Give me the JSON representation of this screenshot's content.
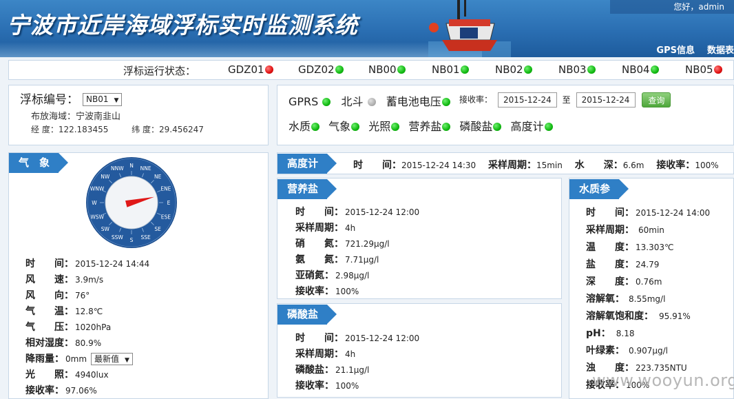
{
  "header": {
    "title": "宁波市近岸海域浮标实时监测系统",
    "user": "您好，admin",
    "nav": [
      "GPS信息",
      "数据表"
    ]
  },
  "status": {
    "label": "浮标运行状态：",
    "items": [
      {
        "name": "GDZ01",
        "state": "red"
      },
      {
        "name": "GDZ02",
        "state": "green"
      },
      {
        "name": "NB00",
        "state": "green"
      },
      {
        "name": "NB01",
        "state": "green"
      },
      {
        "name": "NB02",
        "state": "green"
      },
      {
        "name": "NB03",
        "state": "green"
      },
      {
        "name": "NB04",
        "state": "green"
      },
      {
        "name": "NB05",
        "state": "red"
      }
    ]
  },
  "buoy": {
    "label": "浮标编号：",
    "selected": "NB01",
    "area": "布放海域：宁波南韭山",
    "lon": "经 度：122.183455",
    "lat": "纬 度：29.456247"
  },
  "sensors": {
    "gprs": "GPRS",
    "beidou": "北斗",
    "battery": "蓄电池电压",
    "rate_label": "接收率：",
    "date_from": "2015-12-24",
    "to": "至",
    "date_to": "2015-12-24",
    "query": "查询",
    "row2": [
      "水质",
      "气象",
      "光照",
      "营养盐",
      "磷酸盐",
      "高度计"
    ]
  },
  "weather": {
    "tab": "气　象",
    "compass": [
      "N",
      "NNE",
      "NE",
      "ENE",
      "E",
      "ESE",
      "SE",
      "SSE",
      "S",
      "SSW",
      "SW",
      "WSW",
      "W",
      "WNW",
      "NW",
      "NNW"
    ],
    "direction_deg": 76,
    "rows": [
      {
        "k": "时　　间：",
        "v": "2015-12-24 14:44"
      },
      {
        "k": "风　　速：",
        "v": "3.9m/s"
      },
      {
        "k": "风　　向：",
        "v": "76°"
      },
      {
        "k": "气　　温：",
        "v": "12.8℃"
      },
      {
        "k": "气　　压：",
        "v": "1020hPa"
      },
      {
        "k": "相对湿度：",
        "v": "80.9%"
      },
      {
        "k": "降雨量：",
        "v": "0mm"
      },
      {
        "k": "光　　照：",
        "v": "4940lux"
      },
      {
        "k": "接收率：",
        "v": "97.06%"
      }
    ],
    "rain_select": "最新值"
  },
  "height": {
    "tab": "高度计",
    "time_label": "时　　间：",
    "time": "2015-12-24 14:30",
    "period_label": "采样周期：",
    "period": "15min",
    "depth_label": "水　　深：",
    "depth": "6.6m",
    "rate_label": "接收率：",
    "rate": "100%"
  },
  "nutrient": {
    "tab": "营养盐",
    "rows": [
      {
        "k": "时　　间：",
        "v": "2015-12-24 12:00"
      },
      {
        "k": "采样周期：",
        "v": "4h"
      },
      {
        "k": "硝　　氮：",
        "v": "721.29μg/l"
      },
      {
        "k": "氨　　氮：",
        "v": "7.71μg/l"
      },
      {
        "k": "亚硝氮：",
        "v": "2.98μg/l"
      },
      {
        "k": "接收率：",
        "v": "100%"
      }
    ]
  },
  "phosphate": {
    "tab": "磷酸盐",
    "rows": [
      {
        "k": "时　　间：",
        "v": "2015-12-24 12:00"
      },
      {
        "k": "采样周期：",
        "v": "4h"
      },
      {
        "k": "磷酸盐：",
        "v": "21.1μg/l"
      },
      {
        "k": "接收率：",
        "v": "100%"
      }
    ]
  },
  "waterquality": {
    "tab": "水质参数",
    "rows": [
      {
        "k": "时　　间：",
        "v": "2015-12-24 14:00"
      },
      {
        "k": "采样周期：",
        "v": "60min"
      },
      {
        "k": "温　　度：",
        "v": "13.303℃"
      },
      {
        "k": "盐　　度：",
        "v": "24.79"
      },
      {
        "k": "深　　度：",
        "v": "0.76m"
      },
      {
        "k": "溶解氧：",
        "v": "8.55mg/l"
      },
      {
        "k": "溶解氧饱和度：",
        "v": "95.91%"
      },
      {
        "k": "pH：",
        "v": "8.18"
      },
      {
        "k": "叶绿素：",
        "v": "0.907μg/l"
      },
      {
        "k": "浊　　度：",
        "v": "223.735NTU"
      },
      {
        "k": "接收率：",
        "v": "100%"
      }
    ]
  },
  "watermark": "www.wooyun.org"
}
